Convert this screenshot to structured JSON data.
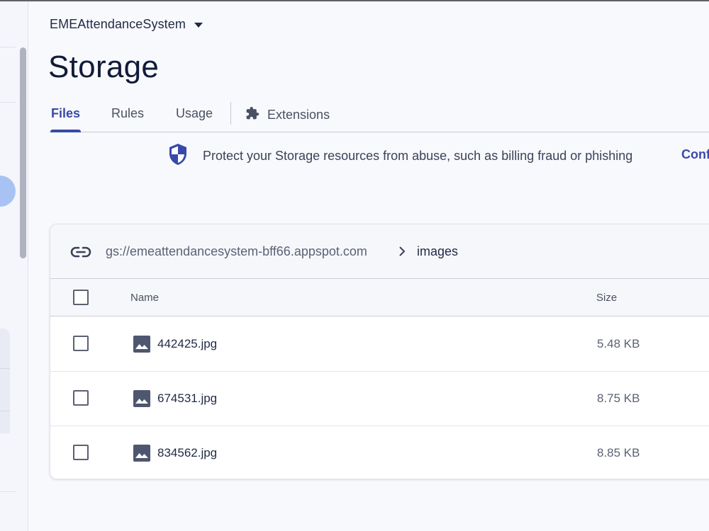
{
  "header": {
    "project_name": "EMEAttendanceSystem",
    "page_title": "Storage"
  },
  "tabs": [
    {
      "label": "Files",
      "active": true
    },
    {
      "label": "Rules",
      "active": false
    },
    {
      "label": "Usage",
      "active": false
    },
    {
      "label": "Extensions",
      "active": false,
      "icon": "puzzle-piece-icon"
    }
  ],
  "banner": {
    "icon": "shield-icon",
    "text": "Protect your Storage resources from abuse, such as billing fraud or phishing",
    "link_text": "Conf"
  },
  "browser": {
    "bucket_path": "gs://emeattendancesystem-bff66.appspot.com",
    "current_folder": "images",
    "columns": {
      "name": "Name",
      "size": "Size"
    },
    "files": [
      {
        "name": "442425.jpg",
        "size": "5.48 KB"
      },
      {
        "name": "674531.jpg",
        "size": "8.75 KB"
      },
      {
        "name": "834562.jpg",
        "size": "8.85 KB"
      }
    ]
  },
  "colors": {
    "accent": "#3949ab",
    "title": "#111b39",
    "background": "#f8f9fc"
  }
}
